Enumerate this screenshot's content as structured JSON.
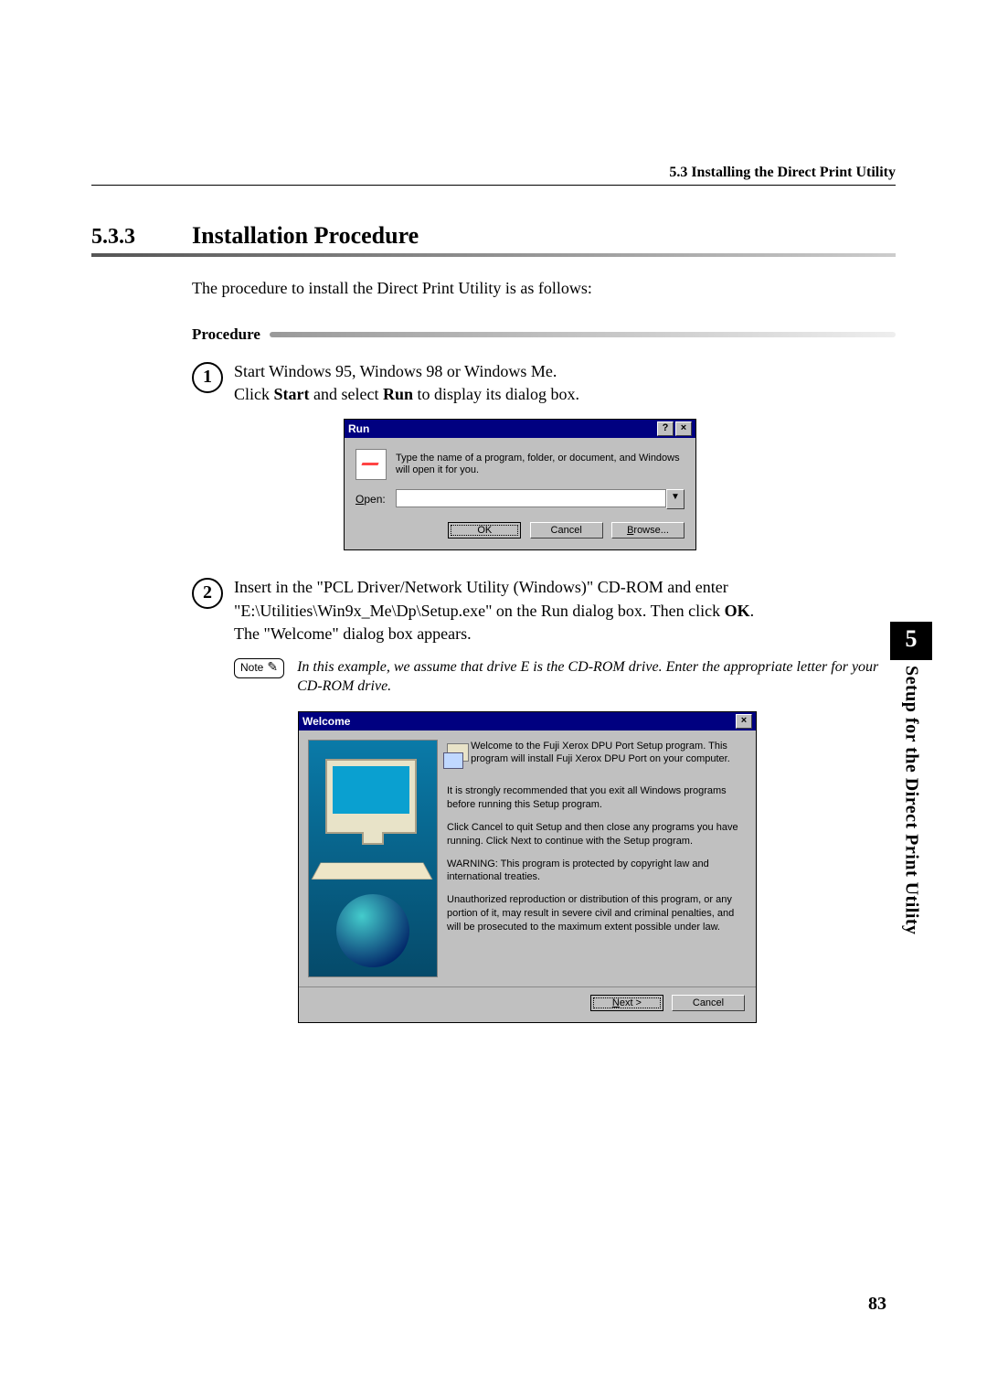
{
  "header": {
    "running_head": "5.3 Installing the Direct Print Utility"
  },
  "section": {
    "number": "5.3.3",
    "title": "Installation Procedure"
  },
  "intro": "The procedure to install the Direct Print Utility is as follows:",
  "procedure_label": "Procedure",
  "steps": {
    "s1": {
      "num": "1",
      "line1": "Start Windows 95, Windows 98 or Windows Me.",
      "line2a": "Click ",
      "line2b_bold": "Start",
      "line2c": " and select ",
      "line2d_bold": "Run",
      "line2e": " to display its dialog box."
    },
    "s2": {
      "num": "2",
      "line1a": "Insert in the \"PCL Driver/Network Utility (Windows)\" CD-ROM and enter \"E:\\Utilities\\Win9x_Me\\Dp\\Setup.exe\" on the Run dialog box. Then click ",
      "line1b_bold": "OK",
      "line1c": ".",
      "line2": "The \"Welcome\" dialog box appears."
    }
  },
  "note": {
    "label": "Note",
    "text": "In this example, we assume that drive E is the CD-ROM drive. Enter the appropriate letter for your CD-ROM drive."
  },
  "run_dialog": {
    "title": "Run",
    "help_btn": "?",
    "close_btn": "×",
    "description": "Type the name of a program, folder, or document, and Windows will open it for you.",
    "open_label": "Open:",
    "open_value": "",
    "dropdown_glyph": "▼",
    "ok": "OK",
    "cancel": "Cancel",
    "browse": "Browse..."
  },
  "welcome_dialog": {
    "title": "Welcome",
    "close_btn": "×",
    "intro": "Welcome to the Fuji Xerox DPU Port Setup program. This program will install Fuji Xerox DPU Port on your computer.",
    "recommend": "It is strongly recommended that you exit all Windows programs before running this Setup program.",
    "quit": "Click Cancel to quit Setup and then close any programs you have running.  Click Next to continue with the Setup program.",
    "warn": "WARNING: This program is protected by copyright law and international treaties.",
    "legal": "Unauthorized reproduction or distribution of this program, or any portion of it, may result in severe civil and criminal penalties, and will be prosecuted to the maximum extent possible under law.",
    "next": "Next >",
    "cancel": "Cancel"
  },
  "side": {
    "chapter": "5",
    "title": "Setup for the Direct Print Utility"
  },
  "page_number": "83"
}
